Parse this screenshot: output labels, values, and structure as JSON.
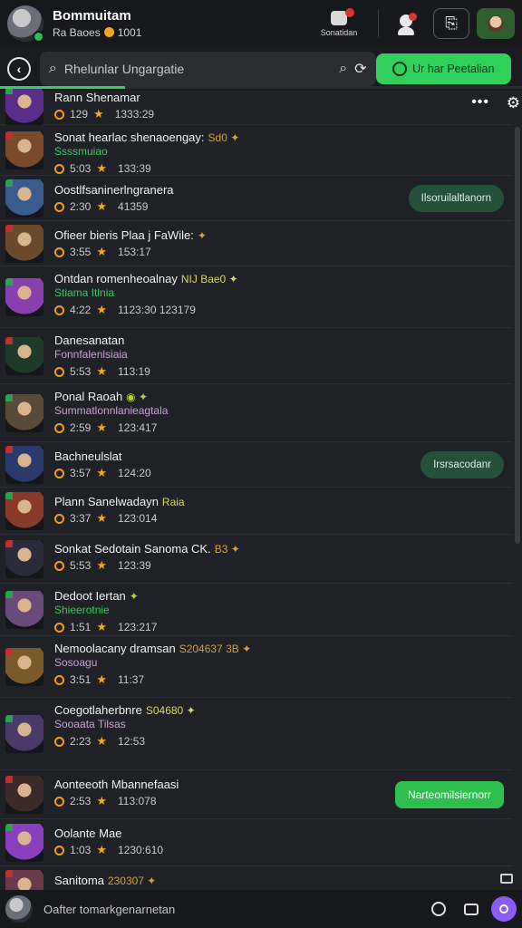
{
  "header": {
    "name": "Bommuitam",
    "sub": "Ra Baoes",
    "coins": "1001",
    "notif_label": "Sonatidan"
  },
  "search": {
    "placeholder": "Rhelunlar Ungargatie",
    "action_label": "Ur har Peetalian"
  },
  "progress_fraction": 0.24,
  "rows": [
    {
      "title": "Rann Shenamar",
      "tags": "",
      "sub": "",
      "stat": "129",
      "time": "1333:29",
      "thumb": "#5b2d8a",
      "action": ""
    },
    {
      "title": "Sonat hearlac shenaoengay:",
      "tags": "Sd0 ✦",
      "sub": "Ssssmuiao",
      "stat": "5:03",
      "time": "133:39",
      "thumb": "#7a4b2a",
      "action": ""
    },
    {
      "title": "Oostlfsaninerlngranera",
      "tags": "",
      "sub": "",
      "stat": "2:30",
      "time": "41359",
      "thumb": "#3a5c8c",
      "action": "Ilsoruilaltlanorn"
    },
    {
      "title": "Ofieer bieris Plaa j FaWile:",
      "tags": "✦",
      "sub": "",
      "stat": "3:55",
      "time": "153:17",
      "thumb": "#6a4a2a",
      "action": ""
    },
    {
      "title": "Ontdan romenheoalnay",
      "tags": "NIJ Bae0 ✦",
      "sub": "Stiama Itlnia",
      "stat": "4:22",
      "time": "1123:30  123179",
      "thumb": "#8a3fae",
      "action": ""
    },
    {
      "title": "Danesanatan",
      "tags": "",
      "sub": "Fonnfalenlsiaia",
      "stat": "5:53",
      "time": "113:19",
      "thumb": "#1d3a2a",
      "action": ""
    },
    {
      "title": "Ponal Raoah",
      "tags": "◉ ✦",
      "sub": "Summatlonnlanieagtala",
      "stat": "2:59",
      "time": "123:417",
      "thumb": "#5a4a38",
      "action": ""
    },
    {
      "title": "Bachneulslat",
      "tags": "",
      "sub": "",
      "stat": "3:57",
      "time": "124:20",
      "thumb": "#2a3a6a",
      "action": "Irsrsacodanr"
    },
    {
      "title": "Plann Sanelwadayn",
      "tags": "Raia",
      "sub": "",
      "stat": "3:37",
      "time": "123:014",
      "thumb": "#8a3a2a",
      "action": ""
    },
    {
      "title": "Sonkat Sedotain Sanoma CK.",
      "tags": "B3 ✦",
      "sub": "",
      "stat": "5:53",
      "time": "123:39",
      "thumb": "#2a2a3a",
      "action": ""
    },
    {
      "title": "Dedoot Iertan",
      "tags": "✦",
      "sub": "Shieerotnie",
      "stat": "1:51",
      "time": "123:217",
      "thumb": "#6a4a7a",
      "action": ""
    },
    {
      "title": "Nemoolacany dramsan",
      "tags": "S204637 3B ✦",
      "sub": "Sosoagu",
      "stat": "3:51",
      "time": "11:37",
      "thumb": "#7a5a2a",
      "action": ""
    },
    {
      "title": "Coegotlaherbnre",
      "tags": "S04680 ✦",
      "sub": "Sooaata Tilsas",
      "stat": "2:23",
      "time": "12:53",
      "thumb": "#4a3a6a",
      "action": ""
    },
    {
      "title": "Aonteeoth Mbannefaasi",
      "tags": "",
      "sub": "",
      "stat": "2:53",
      "time": "113:078",
      "thumb": "#3a2a2a",
      "action": "Narteomilsiernorr"
    },
    {
      "title": "Oolante Mae",
      "tags": "",
      "sub": "",
      "stat": "1:03",
      "time": "1230:610",
      "thumb": "#8a3fbe",
      "action": ""
    },
    {
      "title": "Sanitoma",
      "tags": "230307 ✦",
      "sub": "",
      "stat": "",
      "time": "",
      "thumb": "#6a3a4a",
      "action": ""
    }
  ],
  "composer": {
    "placeholder": "Oafter tomarkgenarnetan"
  }
}
